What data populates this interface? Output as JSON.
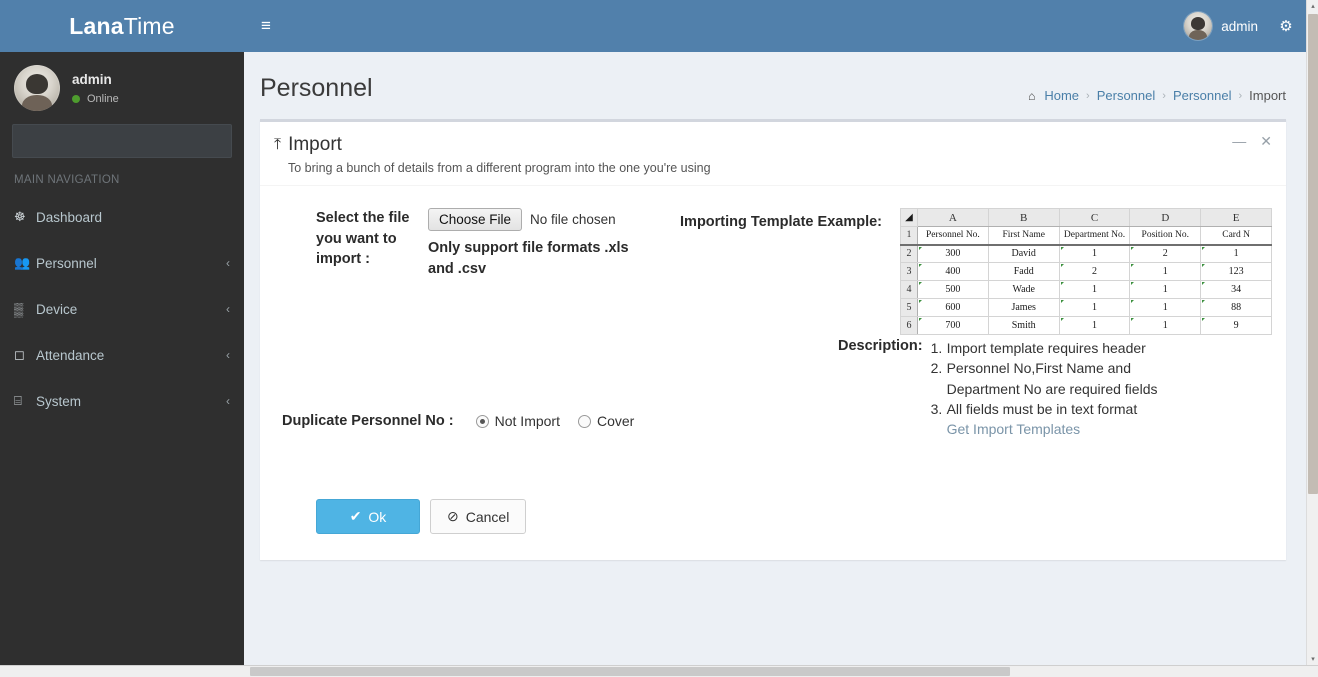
{
  "brand": {
    "bold": "Lana",
    "light": "Time"
  },
  "sidebar": {
    "user": {
      "name": "admin",
      "status": "Online"
    },
    "search_placeholder": "",
    "search_value": "",
    "nav_header": "MAIN NAVIGATION",
    "items": [
      {
        "label": "Dashboard",
        "icon": "dashboard-icon",
        "glyph": "☸",
        "caret": ""
      },
      {
        "label": "Personnel",
        "icon": "users-icon",
        "glyph": "👥",
        "caret": "‹"
      },
      {
        "label": "Device",
        "icon": "device-icon",
        "glyph": "▒",
        "caret": "‹"
      },
      {
        "label": "Attendance",
        "icon": "attendance-icon",
        "glyph": "◻",
        "caret": "‹"
      },
      {
        "label": "System",
        "icon": "monitor-icon",
        "glyph": "⌸",
        "caret": "‹"
      }
    ]
  },
  "topbar": {
    "menu_toggle": "≡",
    "user_name": "admin",
    "gear_glyph": "⚙"
  },
  "page": {
    "title": "Personnel",
    "breadcrumb": {
      "home_icon": "⌂",
      "items": [
        "Home",
        "Personnel",
        "Personnel",
        "Import"
      ],
      "separator": "›"
    }
  },
  "panel": {
    "title": "Import",
    "subtitle": "To bring a bunch of details from a different program into the one you're using",
    "upload_glyph": "⤒",
    "minimize_glyph": "—",
    "close_glyph": "✕"
  },
  "form": {
    "file_label": "Select the file you want to import :",
    "choose_file_button": "Choose File",
    "no_file_text": "No file chosen",
    "file_hint": "Only support file formats .xls and .csv",
    "duplicate_label": "Duplicate Personnel No :",
    "radio_options": [
      {
        "label": "Not Import",
        "checked": true
      },
      {
        "label": "Cover",
        "checked": false
      }
    ],
    "ok_button": "Ok",
    "ok_glyph": "✔",
    "cancel_button": "Cancel",
    "cancel_glyph": "⊘"
  },
  "template_example": {
    "label": "Importing Template Example:",
    "column_letters": [
      "A",
      "B",
      "C",
      "D",
      "E"
    ],
    "corner_glyph": "◢",
    "row_numbers": [
      "1",
      "2",
      "3",
      "4",
      "5",
      "6"
    ],
    "headers": [
      "Personnel No.",
      "First Name",
      "Department No.",
      "Position No.",
      "Card N"
    ],
    "rows": [
      [
        "300",
        "David",
        "1",
        "2",
        "1"
      ],
      [
        "400",
        "Fadd",
        "2",
        "1",
        "123"
      ],
      [
        "500",
        "Wade",
        "1",
        "1",
        "34"
      ],
      [
        "600",
        "James",
        "1",
        "1",
        "88"
      ],
      [
        "700",
        "Smith",
        "1",
        "1",
        "9"
      ]
    ]
  },
  "description": {
    "label": "Description:",
    "items": [
      {
        "num": "1.",
        "lines": [
          "Import template requires header"
        ]
      },
      {
        "num": "2.",
        "lines": [
          "Personnel No,First Name and",
          "Department No are required fields"
        ]
      },
      {
        "num": "3.",
        "lines": [
          "All fields must be in text format"
        ]
      }
    ],
    "link": "Get Import Templates"
  },
  "colors": {
    "brand_blue": "#5180ab",
    "sidebar_dark": "#2f2f2f",
    "ok_blue": "#4fb4e4",
    "content_bg": "#ecf0f5",
    "link_blue": "#4a7fa8",
    "online_green": "#4e9c2e"
  },
  "scrollbars": {
    "vertical_up": "▴",
    "vertical_down": "▾"
  }
}
